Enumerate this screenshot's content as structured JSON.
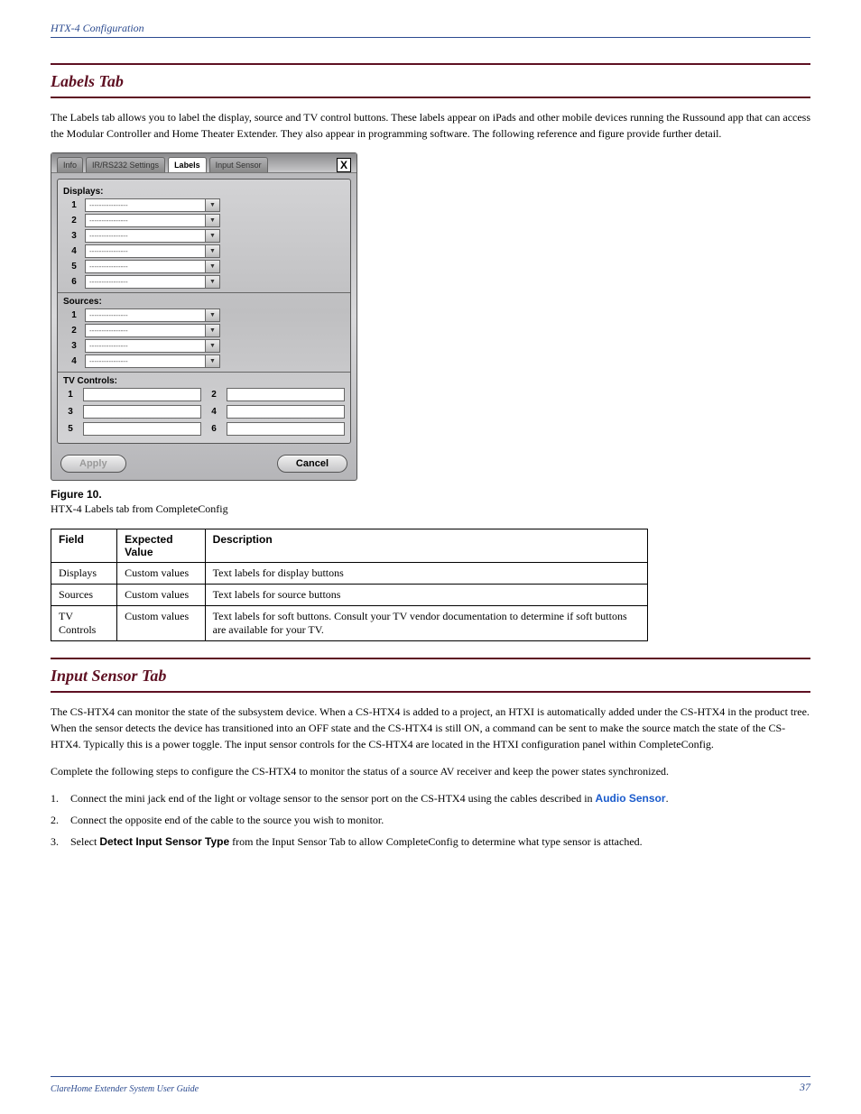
{
  "crumb": "HTX-4 Configuration",
  "section1": {
    "title": "Labels Tab",
    "body": "The Labels tab allows you to label the display, source and TV control buttons. These labels appear on iPads and other mobile devices running the Russound app that can access the Modular Controller and Home Theater Extender. They also appear in programming software. The following reference and figure provide further detail."
  },
  "panel": {
    "tabs": {
      "info": "Info",
      "ir": "IR/RS232 Settings",
      "labels": "Labels",
      "sensor": "Input Sensor"
    },
    "close": "X",
    "displays_label": "Displays:",
    "sources_label": "Sources:",
    "tv_label": "TV Controls:",
    "placeholder": "----------------",
    "display_nums": [
      "1",
      "2",
      "3",
      "4",
      "5",
      "6"
    ],
    "source_nums": [
      "1",
      "2",
      "3",
      "4"
    ],
    "tv_nums": [
      "1",
      "2",
      "3",
      "4",
      "5",
      "6"
    ],
    "apply": "Apply",
    "cancel": "Cancel"
  },
  "figure": {
    "label": "Figure 10.",
    "caption": "HTX-4 Labels tab from CompleteConfig"
  },
  "table": {
    "headers": [
      "Field",
      "Expected Value",
      "Description"
    ],
    "rows": [
      [
        "Displays",
        "Custom values",
        "Text labels for display buttons"
      ],
      [
        "Sources",
        "Custom values",
        "Text labels for source buttons"
      ],
      [
        "TV Controls",
        "Custom values",
        "Text labels for soft buttons. Consult your TV vendor documentation to determine if soft buttons are available for your TV."
      ]
    ]
  },
  "section2": {
    "title": "Input Sensor Tab",
    "para1": "The CS-HTX4 can monitor the state of the subsystem device. When a CS-HTX4 is added to a project, an HTXI is automatically added under the CS-HTX4 in the product tree. When the sensor detects the device has transitioned into an OFF state and the CS-HTX4 is still ON, a command can be sent to make the source match the state of the CS-HTX4. Typically this is a power toggle. The input sensor controls for the CS-HTX4 are located in the HTXI configuration panel within CompleteConfig.",
    "para2": "Complete the following steps to configure the CS-HTX4 to monitor the status of a source AV receiver and keep the power states synchronized.",
    "steps": [
      {
        "n": "1.",
        "body_before": "Connect the mini jack end of the light or voltage sensor to the sensor port on the CS-HTX4 using the cables described in ",
        "link": "Audio Sensor",
        "body_after": "."
      },
      {
        "n": "2.",
        "body": "Connect the opposite end of the cable to the source you wish to monitor."
      },
      {
        "n": "3.",
        "body_before": "Select ",
        "bold": "Detect Input Sensor Type",
        "body_after": " from the Input Sensor Tab to allow CompleteConfig to determine what type sensor is attached."
      }
    ]
  },
  "footer": {
    "left": "ClareHome Extender System User Guide",
    "right": "37"
  }
}
